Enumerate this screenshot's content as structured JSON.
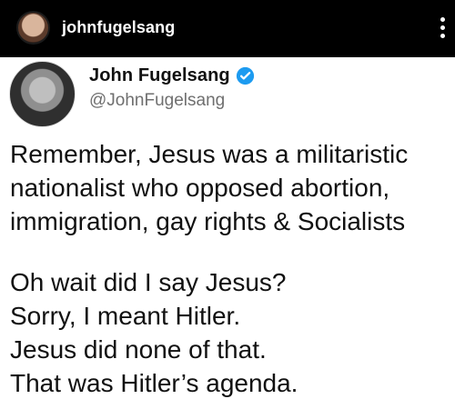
{
  "topbar": {
    "username": "johnfugelsang"
  },
  "post": {
    "name": "John Fugelsang",
    "handle": "@JohnFugelsang",
    "lines_para1": [
      "Remember, Jesus was a militaristic",
      "nationalist who opposed abortion,",
      "immigration, gay rights & Socialists"
    ],
    "lines_para2": [
      "Oh wait did I say Jesus?",
      "Sorry, I meant Hitler.",
      "Jesus did none of that.",
      "That was Hitler’s agenda."
    ],
    "colors": {
      "verified": "#1d9bf0",
      "text": "#111111",
      "handle": "#6f6f6f"
    }
  }
}
